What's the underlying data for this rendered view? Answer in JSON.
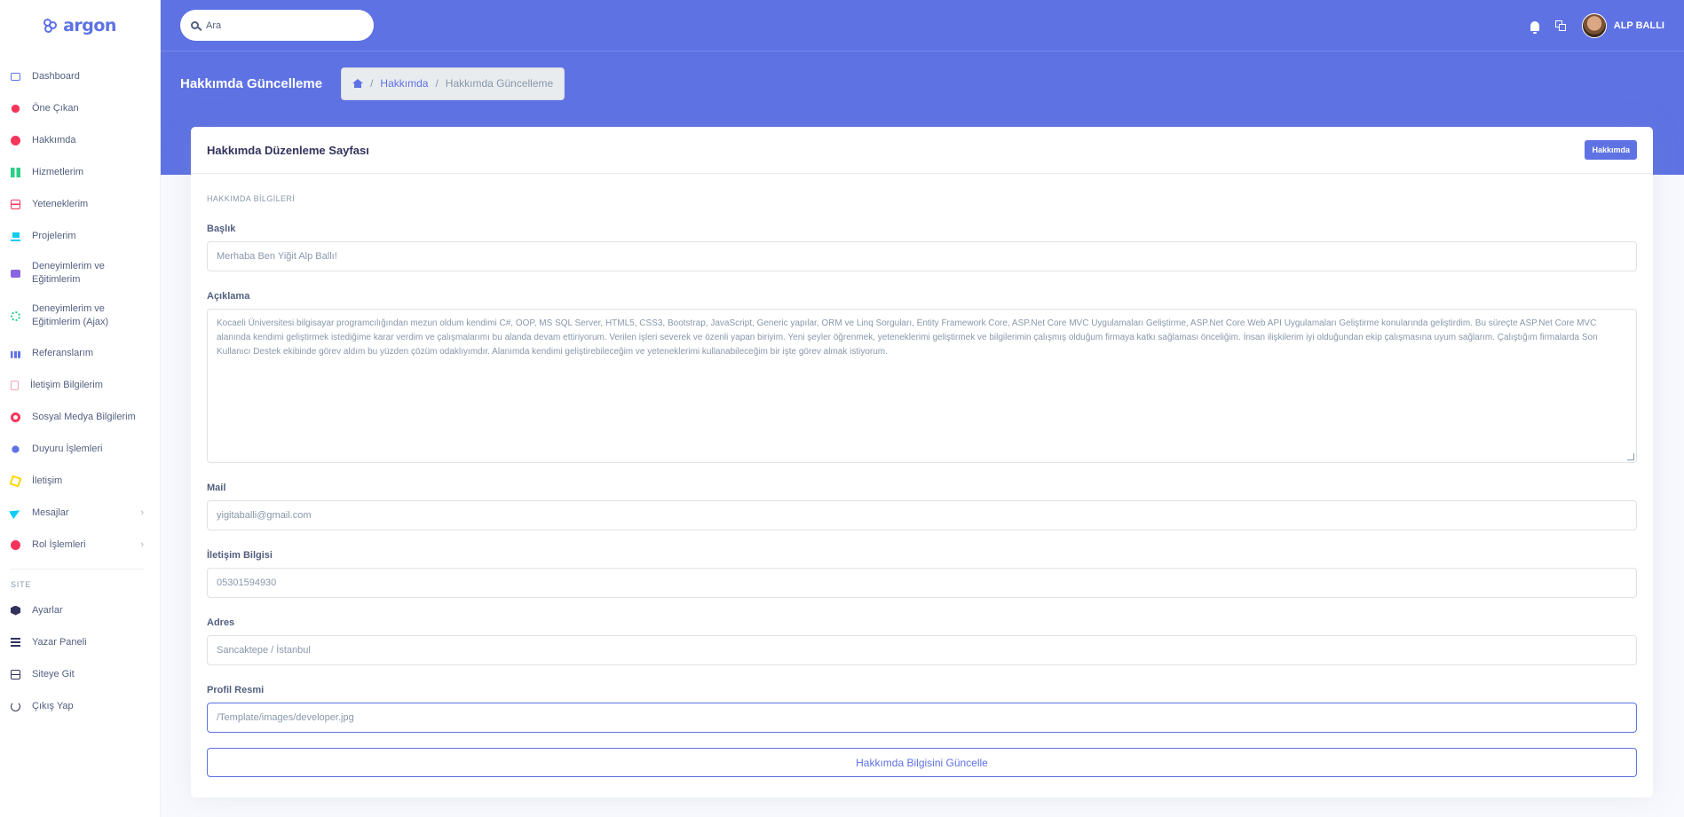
{
  "brand": {
    "name": "argon"
  },
  "sidebar": {
    "items": [
      {
        "label": "Dashboard",
        "icon": "monitor-icon",
        "color": "#5e72e4"
      },
      {
        "label": "Öne Çıkan",
        "icon": "planet-icon",
        "color": "#f5365c"
      },
      {
        "label": "Hakkımda",
        "icon": "smile-icon",
        "color": "#f5365c"
      },
      {
        "label": "Hizmetlerim",
        "icon": "bars-icon",
        "color": "#2dce89"
      },
      {
        "label": "Yeteneklerim",
        "icon": "grid-icon",
        "color": "#f5365c"
      },
      {
        "label": "Projelerim",
        "icon": "laptop-icon",
        "color": "#11cdef"
      },
      {
        "label": "Deneyimlerim ve Eğitimlerim",
        "icon": "briefcase-icon",
        "color": "#8965e0"
      },
      {
        "label": "Deneyimlerim ve Eğitimlerim (Ajax)",
        "icon": "atom-icon",
        "color": "#2dce89"
      },
      {
        "label": "Referanslarım",
        "icon": "chart-bar-icon",
        "color": "#5e72e4"
      },
      {
        "label": "İletişim Bilgilerim",
        "icon": "tablet-icon",
        "color": "#f3a4b5"
      },
      {
        "label": "Sosyal Medya Bilgilerim",
        "icon": "palette-icon",
        "color": "#f5365c"
      },
      {
        "label": "Duyuru İşlemleri",
        "icon": "bulb-icon",
        "color": "#5e72e4"
      },
      {
        "label": "İletişim",
        "icon": "paper-icon",
        "color": "#ffd600"
      },
      {
        "label": "Mesajlar",
        "icon": "send-icon",
        "color": "#11cdef"
      },
      {
        "label": "Rol İşlemleri",
        "icon": "user-icon",
        "color": "#f5365c"
      }
    ],
    "section_title": "SITE",
    "site_items": [
      {
        "label": "Ayarlar",
        "icon": "settings-icon",
        "color": "#32325d"
      },
      {
        "label": "Yazar Paneli",
        "icon": "list-icon",
        "color": "#32325d"
      },
      {
        "label": "Siteye Git",
        "icon": "building-icon",
        "color": "#32325d"
      },
      {
        "label": "Çıkış Yap",
        "icon": "power-icon",
        "color": "#32325d"
      }
    ]
  },
  "search": {
    "placeholder": "Ara"
  },
  "user": {
    "name": "ALP BALLI"
  },
  "page": {
    "title": "Hakkımda Güncelleme"
  },
  "breadcrumb": {
    "link": "Hakkımda",
    "active": "Hakkımda Güncelleme"
  },
  "card": {
    "title": "Hakkımda Düzenleme Sayfası",
    "badge": "Hakkımda",
    "section": "HAKKIMDA BİLGİLERİ",
    "fields": {
      "title": {
        "label": "Başlık",
        "value": "Merhaba Ben Yiğit Alp Ballı!"
      },
      "description": {
        "label": "Açıklama",
        "value": "Kocaeli Üniversitesi bilgisayar programcılığından mezun oldum kendimi C#, OOP, MS SQL Server, HTML5, CSS3, Bootstrap, JavaScript, Generic yapılar, ORM ve Linq Sorguları, Entity Framework Core, ASP.Net Core MVC Uygulamaları Geliştirme, ASP.Net Core Web API Uygulamaları Geliştirme konularında geliştirdim. Bu süreçte ASP.Net Core MVC alanında kendimi geliştirmek istediğime karar verdim ve çalışmalarımı bu alanda devam ettiriyorum. Verilen işleri severek ve özenli yapan biriyim. Yeni şeyler öğrenmek, yeteneklerimi geliştirmek ve bilgilerimin çalışmış olduğum firmaya katkı sağlaması önceliğim. İnsan ilişkilerim iyi olduğundan ekip çalışmasına uyum sağlarım. Çalıştığım firmalarda Son Kullanıcı Destek ekibinde görev aldım bu yüzden çözüm odaklıyımdır. Alanımda kendimi geliştirebileceğim ve yeteneklerimi kullanabileceğim bir işte görev almak istiyorum."
      },
      "mail": {
        "label": "Mail",
        "value": "yigitaballi@gmail.com"
      },
      "contact": {
        "label": "İletişim Bilgisi",
        "value": "05301594930"
      },
      "address": {
        "label": "Adres",
        "value": "Sancaktepe / İstanbul"
      },
      "image": {
        "label": "Profil Resmi",
        "value": "/Template/images/developer.jpg"
      }
    },
    "submit": "Hakkımda Bilgisini Güncelle"
  },
  "colors": {
    "primary": "#5e72e4",
    "background": "#f8f9fe"
  }
}
